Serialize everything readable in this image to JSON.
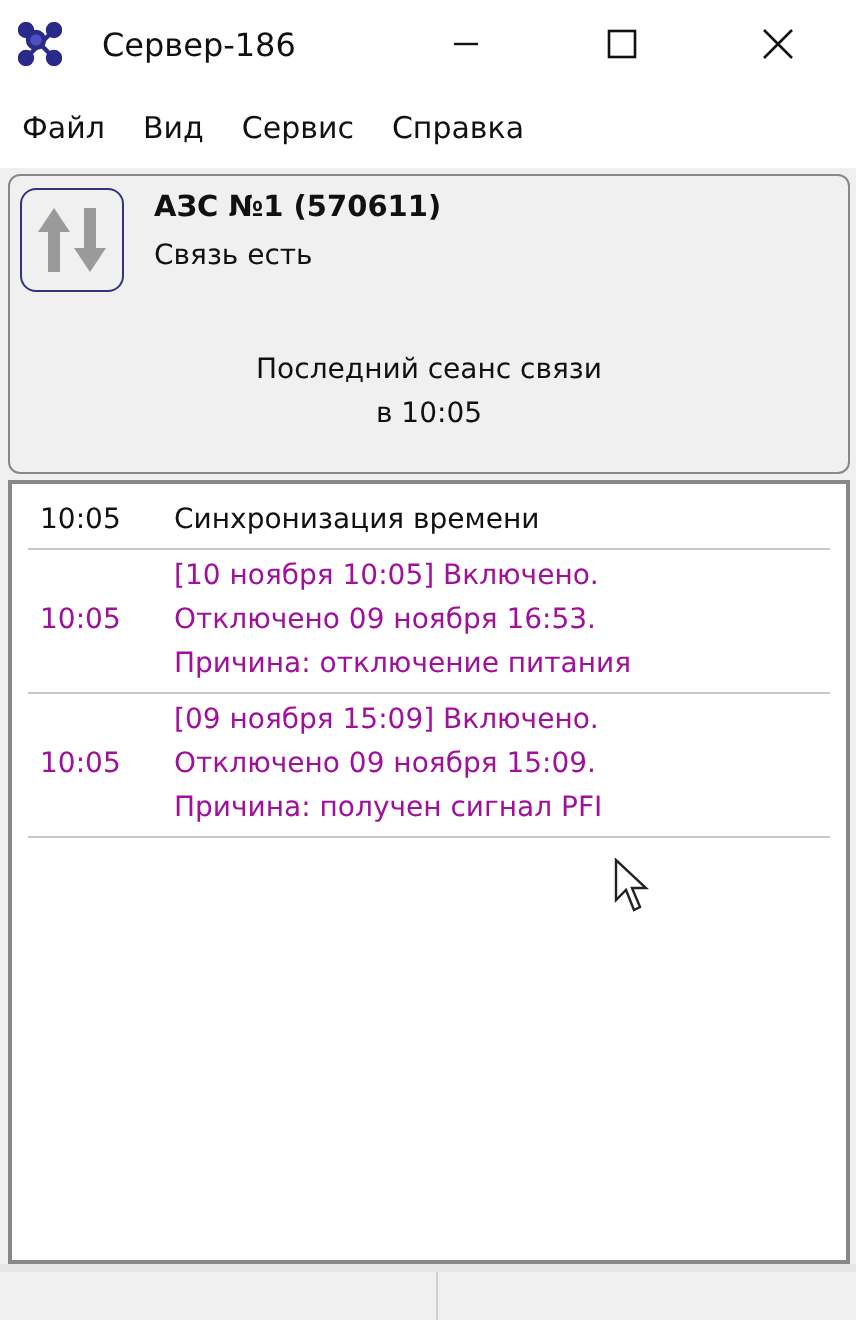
{
  "window": {
    "title": "Сервер-186"
  },
  "menu": [
    "Файл",
    "Вид",
    "Сервис",
    "Справка"
  ],
  "station": {
    "name": "АЗС №1 (570611)",
    "status": "Связь есть",
    "connected": true,
    "last_session": "Последний сеанс связи\nв 10:05"
  },
  "log": [
    {
      "time": "10:05",
      "kind": "info",
      "message": "Синхронизация времени"
    },
    {
      "time": "10:05",
      "kind": "event",
      "message": "[10 ноября 10:05] Включено.\nОтключено 09 ноября 16:53.\nПричина: отключение питания"
    },
    {
      "time": "10:05",
      "kind": "event",
      "message": "[09 ноября 15:09] Включено.\nОтключено 09 ноября 15:09.\nПричина: получен сигнал PFI"
    }
  ]
}
